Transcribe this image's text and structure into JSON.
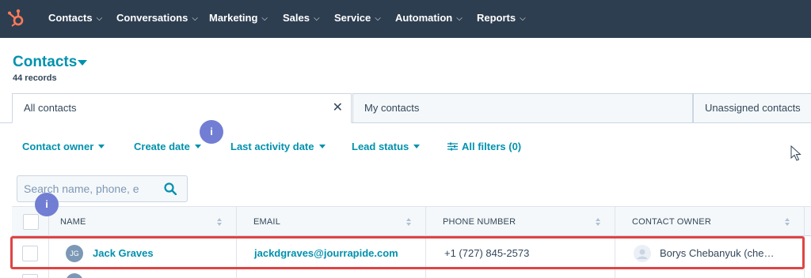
{
  "nav": {
    "items": [
      {
        "label": "Contacts"
      },
      {
        "label": "Conversations"
      },
      {
        "label": "Marketing"
      },
      {
        "label": "Sales"
      },
      {
        "label": "Service"
      },
      {
        "label": "Automation"
      },
      {
        "label": "Reports"
      }
    ],
    "chevron": "⌵"
  },
  "header": {
    "title": "Contacts",
    "record_count": "44 records"
  },
  "views": {
    "tabs": [
      {
        "label": "All contacts",
        "active": true
      },
      {
        "label": "My contacts",
        "active": false
      },
      {
        "label": "Unassigned contacts",
        "active": false
      }
    ],
    "close_glyph": "✕"
  },
  "filters": {
    "items": [
      {
        "label": "Contact owner"
      },
      {
        "label": "Create date"
      },
      {
        "label": "Last activity date"
      },
      {
        "label": "Lead status"
      }
    ],
    "all_filters_label": "All filters (0)"
  },
  "badges": {
    "info_glyph": "i"
  },
  "search": {
    "placeholder": "Search name, phone, e"
  },
  "table": {
    "columns": [
      {
        "label": "NAME"
      },
      {
        "label": "EMAIL"
      },
      {
        "label": "PHONE NUMBER"
      },
      {
        "label": "CONTACT OWNER"
      }
    ],
    "rows": [
      {
        "initials": "JG",
        "name": "Jack Graves",
        "email": "jackdgraves@jourrapide.com",
        "phone": "+1 (727) 845-2573",
        "owner": "Borys Chebanyuk (che…"
      }
    ]
  },
  "colors": {
    "nav_bg": "#2d3e50",
    "accent": "#0091ae",
    "brand_orange": "#ff7a59",
    "info_badge": "#6a78d1",
    "highlight": "#e04444"
  }
}
